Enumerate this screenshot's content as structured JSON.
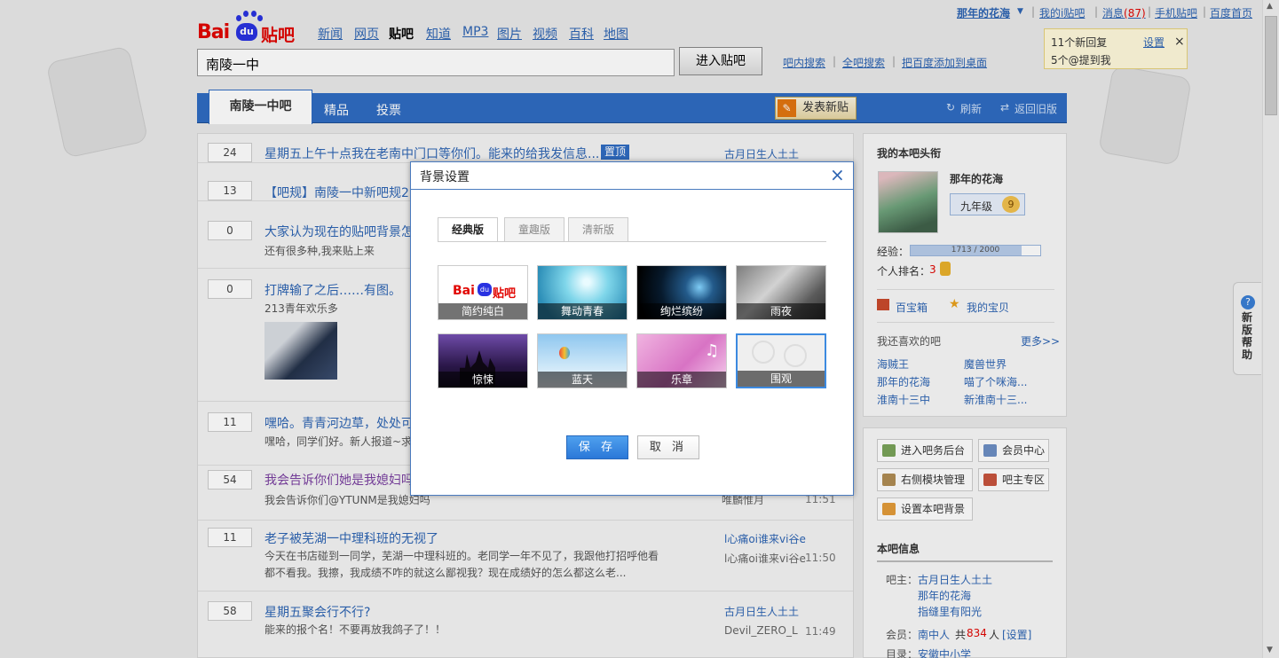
{
  "header": {
    "user_name": "那年的花海",
    "links": [
      "我的i贴吧",
      "消息",
      "手机贴吧",
      "百度首页"
    ],
    "message_count": "(87)",
    "logo_text_bai": "Bai",
    "logo_text_du": "du",
    "logo_text_tieba": "贴吧",
    "nav": [
      "新闻",
      "网页",
      "贴吧",
      "知道",
      "MP3",
      "图片",
      "视频",
      "百科",
      "地图"
    ],
    "search_value": "南陵一中",
    "enter_button": "进入贴吧",
    "search_links": [
      "吧内搜索",
      "全吧搜索",
      "把百度添加到桌面"
    ]
  },
  "notice": {
    "line1": "11个新回复",
    "line2": "5个@提到我",
    "settings": "设置",
    "close": "×"
  },
  "tabbar": {
    "active_tab": "南陵一中吧",
    "tabs": [
      "精品",
      "投票"
    ],
    "post_button": "发表新贴",
    "refresh": "刷新",
    "old_version": "返回旧版"
  },
  "threads": [
    {
      "replies": "24",
      "title": "星期五上午十点我在老南中门口等你们。能来的给我发信息...",
      "badge": "置顶",
      "author": "古月日生人土土"
    },
    {
      "replies": "13",
      "title": "【吧规】南陵一中新吧规2"
    },
    {
      "replies": "0",
      "title": "大家认为现在的贴吧背景怎",
      "excerpt": "还有很多种,我来贴上来"
    },
    {
      "replies": "0",
      "title": "打牌输了之后……有图。",
      "excerpt": "213青年欢乐多"
    },
    {
      "replies": "11",
      "title": "嘿哈。青青河边草，处处可",
      "excerpt": "嘿哈，同学们好。新人报道~求"
    },
    {
      "replies": "54",
      "title": "我会告诉你们她是我媳妇吗",
      "excerpt": "我会告诉你们@YTUNM是我媳妇吗",
      "author2": "唯麟惟月",
      "time": "11:51"
    },
    {
      "replies": "11",
      "title": "老子被芜湖一中理科班的无视了",
      "excerpt": "今天在书店碰到一同学，芜湖一中理科班的。老同学一年不见了，我跟他打招呼他看",
      "excerpt2": "都不看我。我擦，我成绩不咋的就这么鄙视我？现在成绩好的怎么都这么老...",
      "author": "l心痛oi谁来vi谷e",
      "author2": "l心痛oi谁来vi谷e",
      "time": "11:50"
    },
    {
      "replies": "58",
      "title": "星期五聚会行不行?",
      "excerpt": "能来的报个名！不要再放我鸽子了！！",
      "author": "古月日生人土土",
      "author2": "Devil_ZERO_L",
      "time": "11:49"
    }
  ],
  "sidebar": {
    "title": "我的本吧头衔",
    "user": "那年的花海",
    "level": "九年级",
    "level_num": "9",
    "exp_label": "经验：",
    "exp_value": "1713 / 2000",
    "exp_fraction": 0.8565,
    "rank_label": "个人排名：",
    "rank_value": "3",
    "treasure": "百宝箱",
    "my_treasure": "我的宝贝",
    "likes_title": "我还喜欢的吧",
    "more": "更多>>",
    "likes": [
      "海贼王",
      "魔兽世界",
      "那年的花海",
      "喵了个咪海...",
      "淮南十三中",
      "新淮南十三..."
    ],
    "buttons": [
      "进入吧务后台",
      "会员中心",
      "右侧模块管理",
      "吧主专区",
      "设置本吧背景"
    ],
    "info_title": "本吧信息",
    "owner_label": "吧主：",
    "owners": [
      "古月日生人土土",
      "那年的花海",
      "指缝里有阳光"
    ],
    "member_label": "会员：",
    "member_name": "南中人",
    "member_total_prefix": "共",
    "member_count": "834",
    "member_total_suffix": "人",
    "member_settings": "[设置]",
    "dir_label": "目录：",
    "dir_value": "安徽中小学"
  },
  "dialog": {
    "title": "背景设置",
    "tabs": [
      "经典版",
      "童趣版",
      "清新版"
    ],
    "themes": [
      "简约纯白",
      "舞动青春",
      "绚烂缤纷",
      "雨夜",
      "惊悚",
      "蓝天",
      "乐章",
      "围观"
    ],
    "thumb_logo_bai": "Bai",
    "thumb_logo_du": "du",
    "thumb_logo_tieba": "贴吧",
    "save": "保 存",
    "cancel": "取 消"
  },
  "help": {
    "icon": "?",
    "text": "新版帮助"
  },
  "colors": {
    "accent": "#2f6cc2",
    "link": "#2d64b3",
    "brand_red": "#e10602",
    "brand_blue": "#2932e1"
  }
}
